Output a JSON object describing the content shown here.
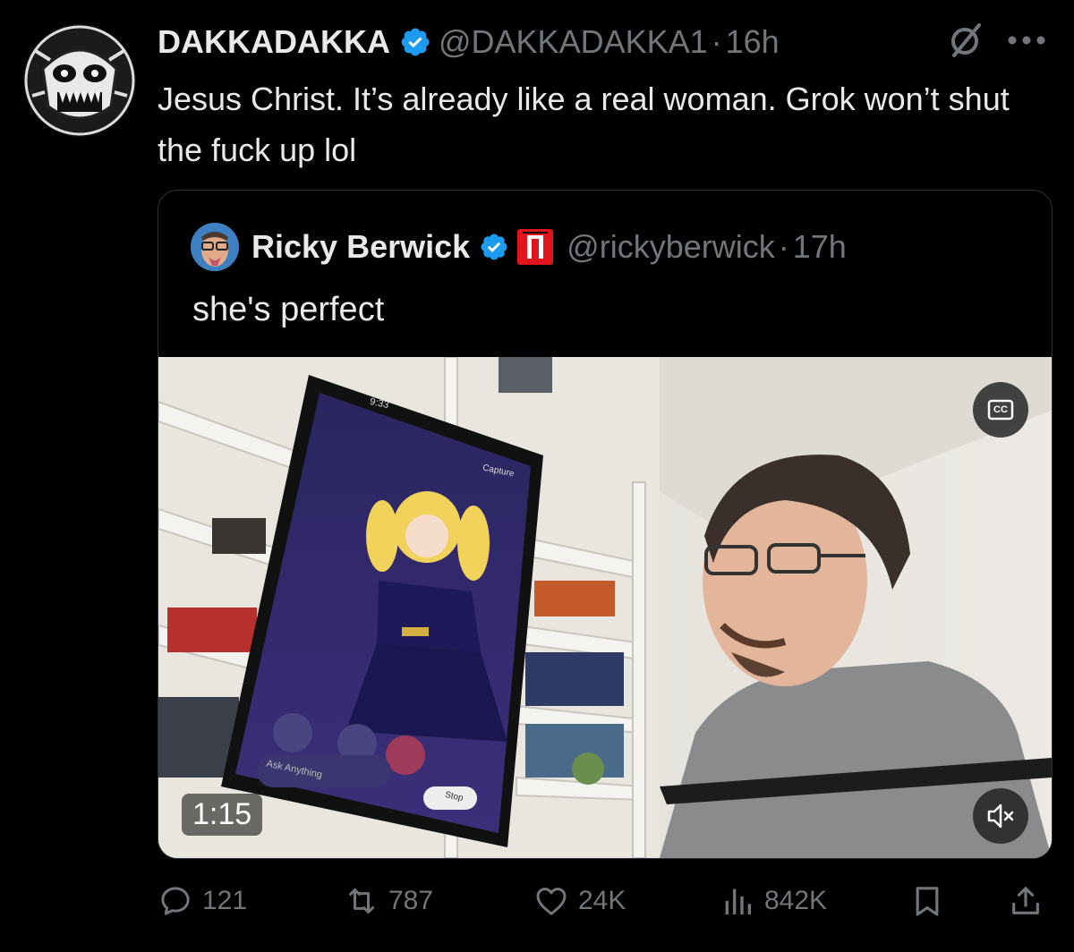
{
  "tweet": {
    "display_name": "DAKKADAKKA",
    "handle": "@DAKKADAKKA1",
    "separator": "·",
    "time": "16h",
    "text": "Jesus Christ. It’s already like a real woman. Grok won’t shut the fuck up lol"
  },
  "quote": {
    "display_name": "Ricky Berwick",
    "handle": "@rickyberwick",
    "separator": "·",
    "time": "17h",
    "text": "she's perfect",
    "video": {
      "duration": "1:15",
      "cc_label": "CC",
      "phone_time": "9:33",
      "phone_capture": "Capture",
      "phone_ask": "Ask Anything",
      "phone_stop": "Stop"
    }
  },
  "actions": {
    "replies": "121",
    "reposts": "787",
    "likes": "24K",
    "views": "842K"
  },
  "colors": {
    "background": "#000000",
    "text": "#e7e9ea",
    "muted": "#71767b",
    "verified": "#1d9bf0",
    "border": "#2f3336"
  },
  "icons": [
    "verified-badge-icon",
    "grok-icon",
    "more-icon",
    "cc-icon",
    "mute-icon",
    "reply-icon",
    "repost-icon",
    "like-icon",
    "views-icon",
    "bookmark-icon",
    "share-icon"
  ]
}
